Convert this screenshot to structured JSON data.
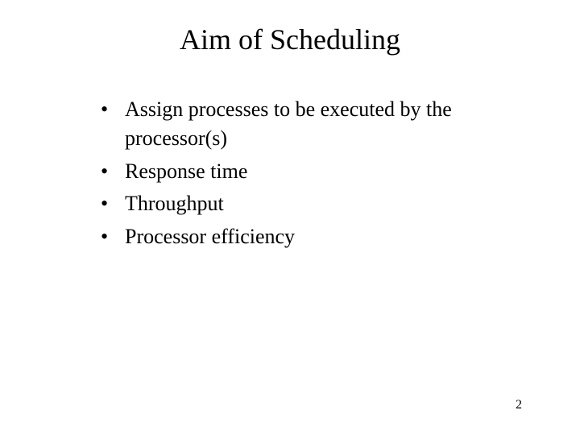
{
  "title": "Aim of Scheduling",
  "bullets": {
    "b0": "Assign processes to be executed by the processor(s)",
    "b1": "Response time",
    "b2": "Throughput",
    "b3": "Processor efficiency"
  },
  "page_number": "2"
}
